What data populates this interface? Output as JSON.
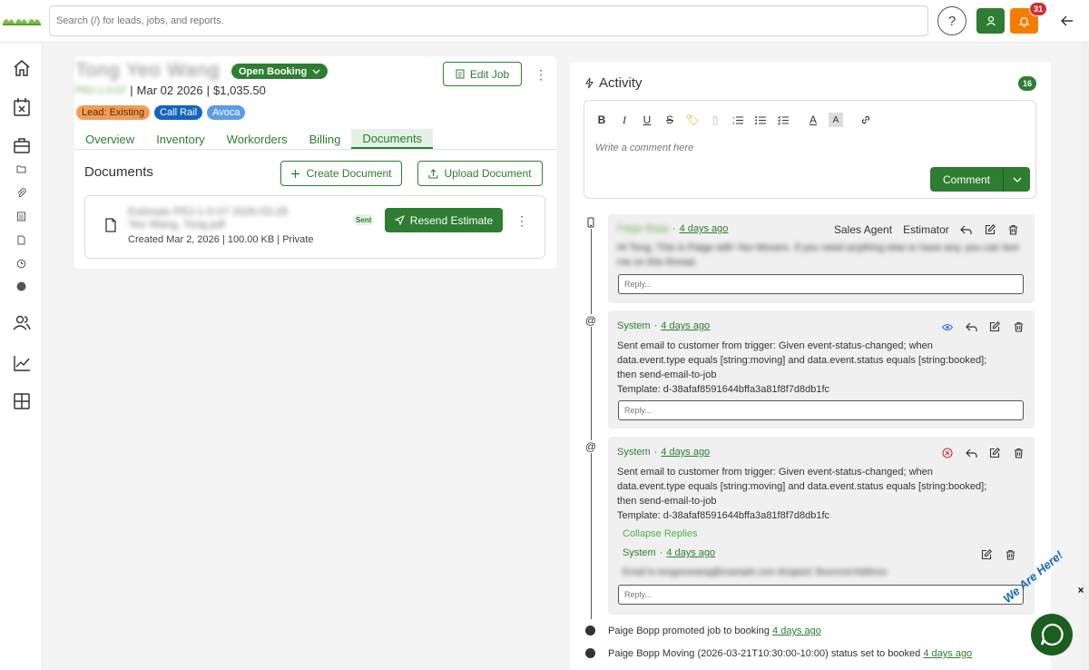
{
  "topbar": {
    "search_placeholder": "Search (/) for leads, jobs, and reports.",
    "notification_count": "31",
    "help_label": "?"
  },
  "job": {
    "customer_name": "Tong Yeo Wang",
    "booking_status": "Open Booking",
    "job_id": "PRJ-1-0-07",
    "date": "Mar 02 2026",
    "amount": "$1,035.50",
    "edit_label": "Edit Job",
    "tags": [
      "Lead: Existing",
      "Call Rail",
      "Avoca"
    ]
  },
  "tabs": [
    {
      "label": "Overview",
      "active": false
    },
    {
      "label": "Inventory",
      "active": false
    },
    {
      "label": "Workorders",
      "active": false
    },
    {
      "label": "Billing",
      "active": false
    },
    {
      "label": "Documents",
      "active": true
    }
  ],
  "documents": {
    "title": "Documents",
    "create_label": "Create Document",
    "upload_label": "Upload Document",
    "item": {
      "name_line1": "Estimate PRJ-1-0-07 2026-03-28",
      "name_line2": "Yeo Wang, Tong.pdf",
      "meta": "Created Mar 2, 2026 | 100.00 KB | Private",
      "status": "Sent",
      "resend_label": "Resend Estimate"
    }
  },
  "activity": {
    "title": "Activity",
    "count": "16",
    "comment_placeholder": "Write a comment here",
    "comment_label": "Comment",
    "reply_placeholder": "Reply...",
    "entries": [
      {
        "author": "Paige Bopp",
        "time": "4 days ago",
        "roles": [
          "Sales Agent",
          "Estimator"
        ],
        "body": "Hi Tong, This is Paige with Yeo Movers. If you need anything else or have any, you can text me on this thread."
      },
      {
        "author": "System",
        "time": "4 days ago",
        "body_lines": [
          "Sent email to customer from trigger: Given event-status-changed; when",
          "data.event.type equals [string:moving] and data.event.status equals [string:booked];",
          "then send-email-to-job",
          "Template: d-38afaf8591644bffa3a81f8f7d8db1fc"
        ]
      },
      {
        "author": "System",
        "time": "4 days ago",
        "body_lines": [
          "Sent email to customer from trigger: Given event-status-changed; when",
          "data.event.type equals [string:moving] and data.event.status equals [string:booked];",
          "then send-email-to-job",
          "Template: d-38afaf8591644bffa3a81f8f7d8db1fc"
        ],
        "collapse_label": "Collapse Replies",
        "reply": {
          "author": "System",
          "time": "4 days ago",
          "body": "Email to tongyeowang@example.com dropped: Bounced Address"
        }
      }
    ],
    "events": [
      {
        "text": "Paige Bopp promoted job to booking",
        "time": "4 days ago"
      },
      {
        "text": "Paige Bopp Moving (2026-03-21T10:30:00-10:00) status set to booked",
        "time": "4 days ago"
      }
    ]
  },
  "chat": {
    "tagline": "We Are Here!",
    "close": "×"
  },
  "colors": {
    "brand_green": "#2e7d32",
    "notification_orange": "#f57c00",
    "badge_red": "#d32f2f"
  }
}
